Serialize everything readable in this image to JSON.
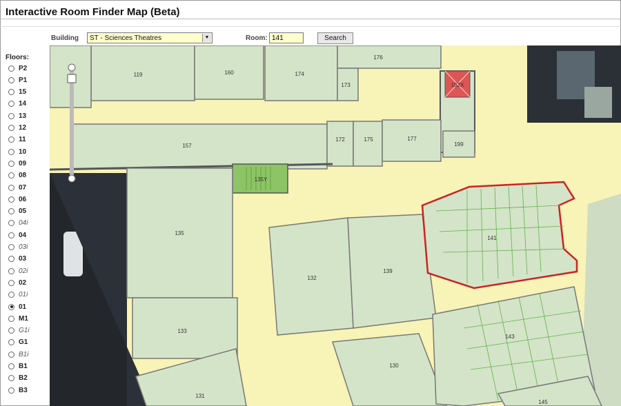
{
  "app": {
    "title": "Interactive Room Finder Map (Beta)"
  },
  "search": {
    "building_label": "Building",
    "building_value": "ST - Sciences Theatres",
    "room_label": "Room:",
    "room_value": "141",
    "button_label": "Search"
  },
  "floors": {
    "label": "Floors:",
    "selected": "01",
    "items": [
      "P2",
      "P1",
      "15",
      "14",
      "13",
      "12",
      "11",
      "10",
      "09",
      "08",
      "07",
      "06",
      "05",
      "04i",
      "04",
      "03i",
      "03",
      "02i",
      "02",
      "01i",
      "01",
      "M1",
      "G1i",
      "G1",
      "B1i",
      "B1",
      "B2",
      "B3"
    ]
  },
  "map": {
    "highlighted_room": "141",
    "rooms": [
      "119",
      "160",
      "174",
      "176",
      "173",
      "102X",
      "157",
      "172",
      "175",
      "177",
      "199",
      "135Y",
      "135",
      "141",
      "132",
      "139",
      "133",
      "143",
      "130",
      "131",
      "145"
    ],
    "colors": {
      "room_fill": "#d4e4c8",
      "corridor": "#f8f3b6",
      "wall": "#777777",
      "highlight": "#cc2222",
      "stair_fill": "#8cc466",
      "red_room": "#dd5555",
      "exterior": "#222222"
    }
  }
}
